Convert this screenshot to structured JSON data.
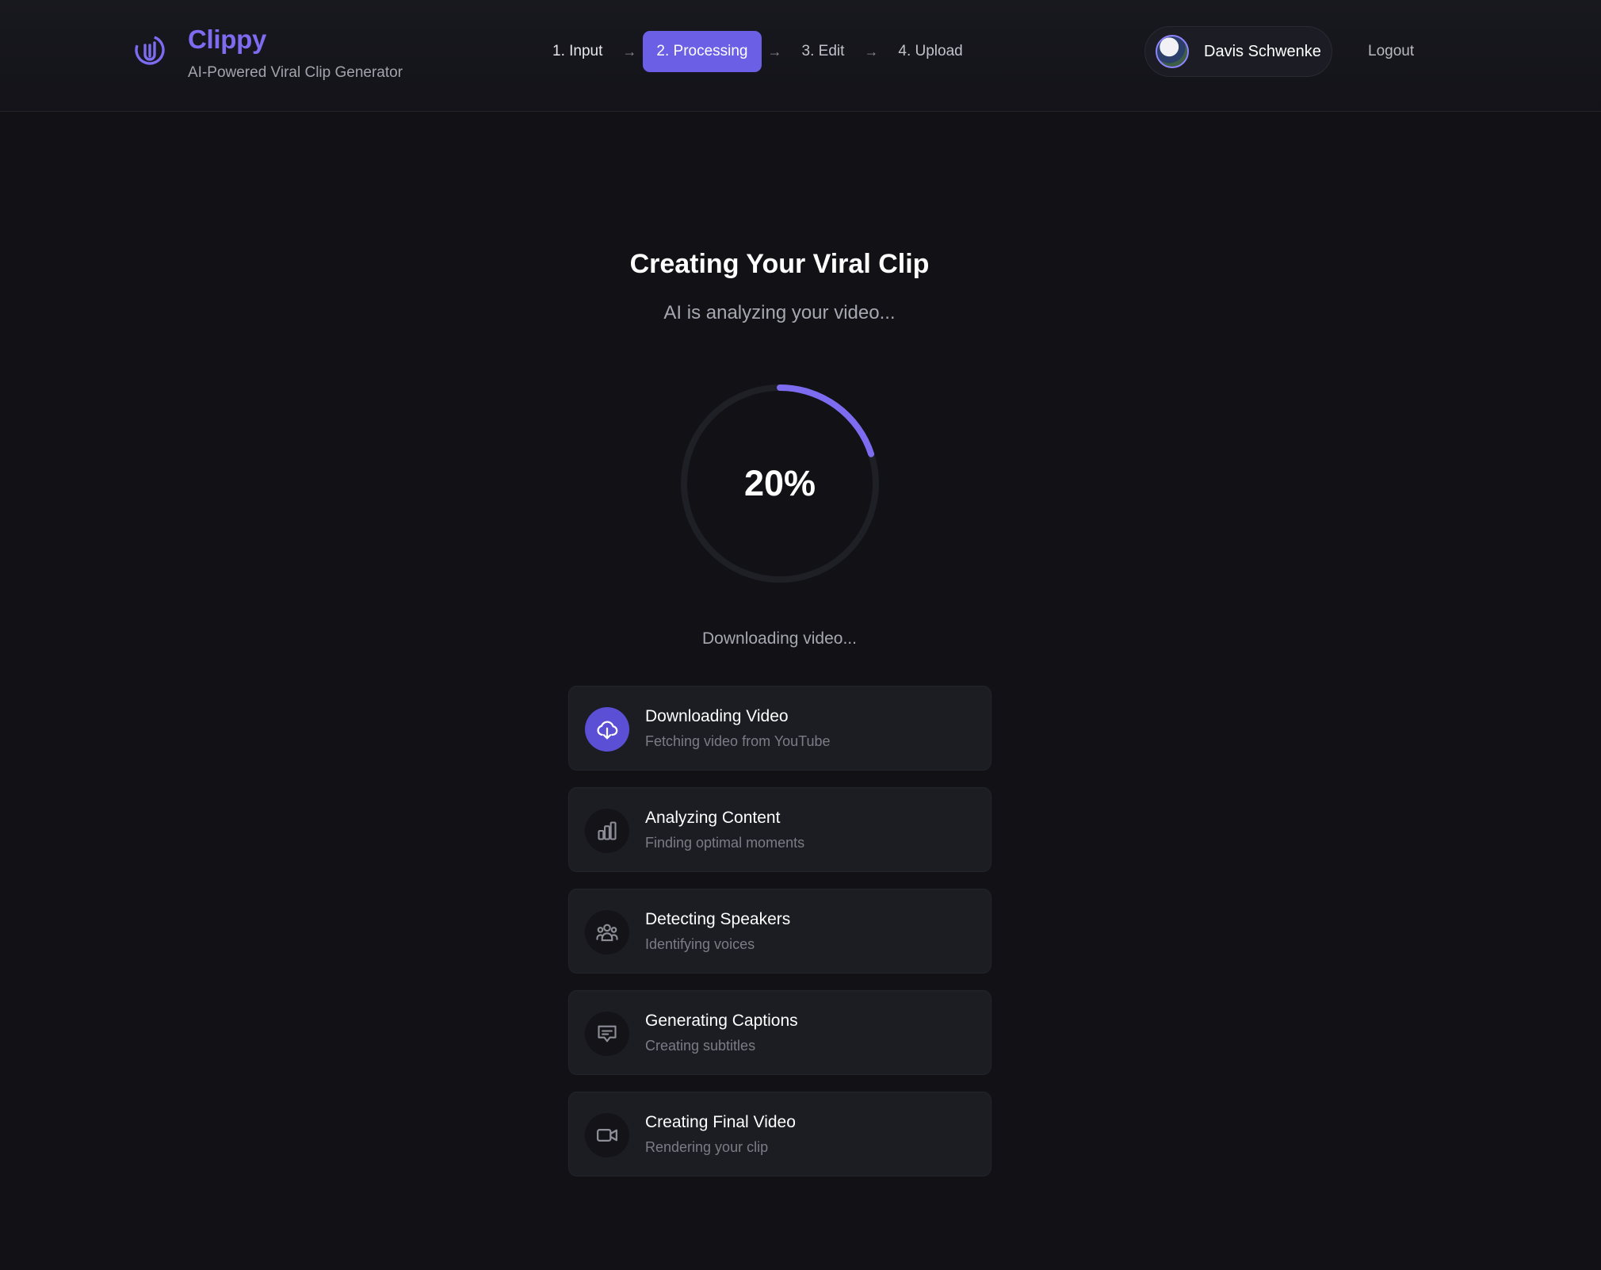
{
  "brand": {
    "name": "Clippy",
    "tagline": "AI-Powered Viral Clip Generator",
    "accent_color": "#7d6cf0",
    "logo_icon": "paperclip-icon"
  },
  "steps": [
    {
      "label": "1. Input",
      "state": "done"
    },
    {
      "label": "2. Processing",
      "state": "active"
    },
    {
      "label": "3. Edit",
      "state": "pending"
    },
    {
      "label": "4. Upload",
      "state": "pending"
    }
  ],
  "step_separator_icon": "arrow-right-icon",
  "user": {
    "name": "Davis Schwenke",
    "logout_label": "Logout"
  },
  "main": {
    "title": "Creating Your Viral Clip",
    "subtitle": "AI is analyzing your video...",
    "progress_percent": 20,
    "progress_label": "20%",
    "progress_color": "#7d6cf0",
    "status": "Downloading video..."
  },
  "tasks": [
    {
      "title": "Downloading Video",
      "description": "Fetching video from YouTube",
      "icon": "cloud-download-icon",
      "state": "active"
    },
    {
      "title": "Analyzing Content",
      "description": "Finding optimal moments",
      "icon": "bar-chart-icon",
      "state": "pending"
    },
    {
      "title": "Detecting Speakers",
      "description": "Identifying voices",
      "icon": "users-icon",
      "state": "pending"
    },
    {
      "title": "Generating Captions",
      "description": "Creating subtitles",
      "icon": "message-square-icon",
      "state": "pending"
    },
    {
      "title": "Creating Final Video",
      "description": "Rendering your clip",
      "icon": "video-camera-icon",
      "state": "pending"
    }
  ]
}
